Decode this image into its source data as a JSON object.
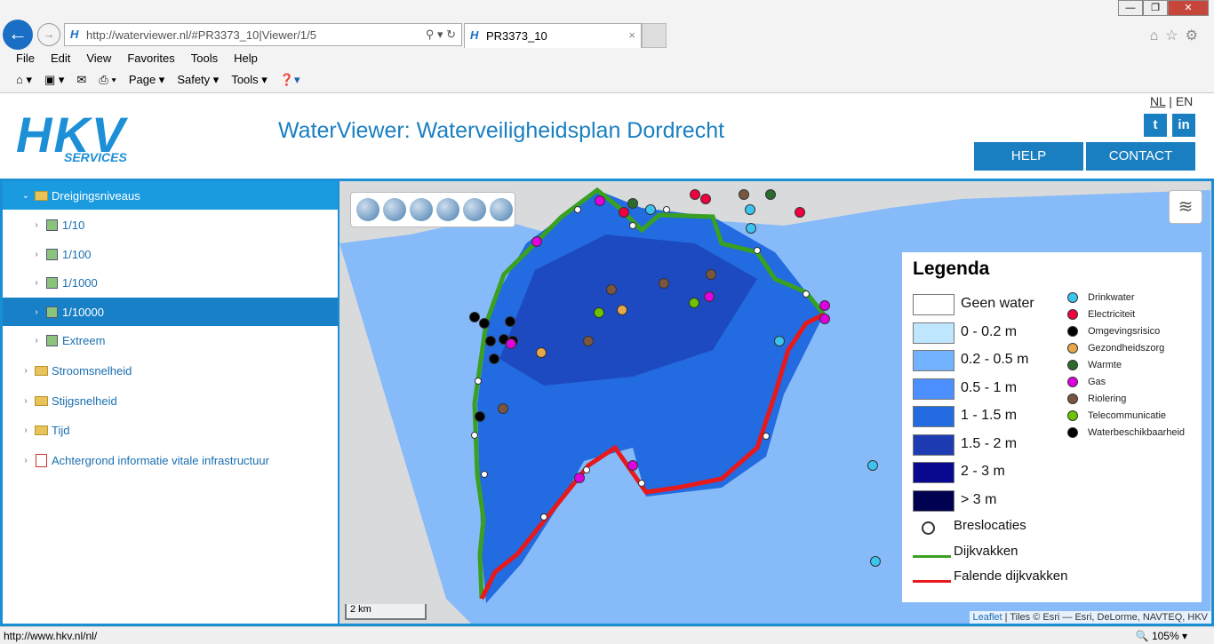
{
  "browser": {
    "back": "←",
    "forward": "→",
    "url": "http://waterviewer.nl/#PR3373_10|Viewer/1/5",
    "tab_title": "PR3373_10",
    "tab_close": "×",
    "menu": [
      "File",
      "Edit",
      "View",
      "Favorites",
      "Tools",
      "Help"
    ],
    "toolbar": [
      "Page ▾",
      "Safety ▾",
      "Tools ▾"
    ],
    "window_controls": [
      "—",
      "❐",
      "✕"
    ]
  },
  "header": {
    "logo_text": "HKV",
    "logo_sub": "SERVICES",
    "title": "WaterViewer: Waterveiligheidsplan Dordrecht",
    "lang_nl": "NL",
    "lang_sep": "|",
    "lang_en": "EN",
    "twitter": "t",
    "linkedin": "in",
    "help": "HELP",
    "contact": "CONTACT"
  },
  "tree": [
    {
      "label": "Dreigingsniveaus",
      "type": "folder",
      "level": 0,
      "expanded": true,
      "state": "header"
    },
    {
      "label": "1/10",
      "type": "layer",
      "level": 1
    },
    {
      "label": "1/100",
      "type": "layer",
      "level": 1
    },
    {
      "label": "1/1000",
      "type": "layer",
      "level": 1
    },
    {
      "label": "1/10000",
      "type": "layer",
      "level": 1,
      "state": "selected"
    },
    {
      "label": "Extreem",
      "type": "layer",
      "level": 1
    },
    {
      "label": "Stroomsnelheid",
      "type": "folder",
      "level": 0
    },
    {
      "label": "Stijgsnelheid",
      "type": "folder",
      "level": 0
    },
    {
      "label": "Tijd",
      "type": "folder",
      "level": 0
    },
    {
      "label": "Achtergrond informatie vitale infrastructuur",
      "type": "pdf",
      "level": 0
    }
  ],
  "legend": {
    "title": "Legenda",
    "depth": [
      {
        "label": "Geen water",
        "color": "#ffffff"
      },
      {
        "label": "0 - 0.2 m",
        "color": "#bfe6ff"
      },
      {
        "label": "0.2 - 0.5 m",
        "color": "#73b2ff"
      },
      {
        "label": "0.5 - 1 m",
        "color": "#4c90ff"
      },
      {
        "label": "1 - 1.5 m",
        "color": "#226be0"
      },
      {
        "label": "1.5 - 2 m",
        "color": "#1d3cb4"
      },
      {
        "label": "2 - 3 m",
        "color": "#080890"
      },
      {
        "label": "> 3 m",
        "color": "#000050"
      }
    ],
    "breach": "Breslocaties",
    "dike": "Dijkvakken",
    "dike_color": "#3aa021",
    "failing": "Falende dijkvakken",
    "failing_color": "#e8191b",
    "categories": [
      {
        "label": "Drinkwater",
        "color": "#3cc4f0"
      },
      {
        "label": "Electriciteit",
        "color": "#f0003c"
      },
      {
        "label": "Omgevingsrisico",
        "color": "#000000"
      },
      {
        "label": "Gezondheidszorg",
        "color": "#e8a84a"
      },
      {
        "label": "Warmte",
        "color": "#2d6a2d"
      },
      {
        "label": "Gas",
        "color": "#e000e0"
      },
      {
        "label": "Riolering",
        "color": "#7a5540"
      },
      {
        "label": "Telecommunicatie",
        "color": "#6cc400"
      },
      {
        "label": "Waterbeschikbaarheid",
        "color": "#000000"
      }
    ]
  },
  "map": {
    "scale": "2 km",
    "attribution_link": "Leaflet",
    "attribution": " | Tiles © Esri — Esri, DeLorme, NAVTEQ, HKV"
  },
  "status": {
    "url": "http://www.hkv.nl/nl/",
    "zoom": "🔍 105% ▾"
  }
}
